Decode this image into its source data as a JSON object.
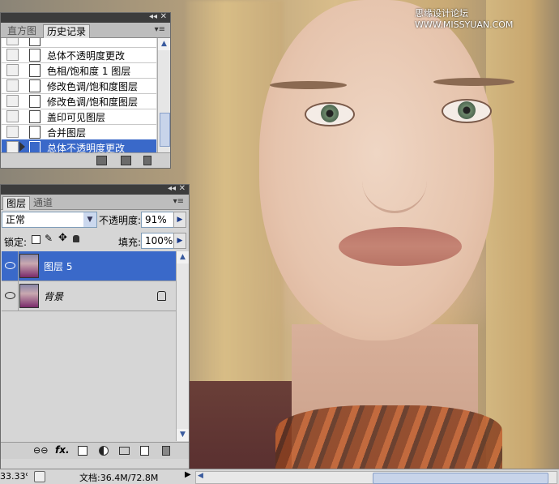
{
  "watermark": "思缘设计论坛 WWW.MISSYUAN.COM",
  "history_panel": {
    "tabs": [
      "直方图",
      "历史记录"
    ],
    "items": [
      {
        "label": "总体不透明度更改",
        "selected": false
      },
      {
        "label": "色相/饱和度 1 图层",
        "selected": false
      },
      {
        "label": "修改色调/饱和度图层",
        "selected": false
      },
      {
        "label": "修改色调/饱和度图层",
        "selected": false
      },
      {
        "label": "盖印可见图层",
        "selected": false
      },
      {
        "label": "合并图层",
        "selected": false
      },
      {
        "label": "总体不透明度更改",
        "selected": true
      }
    ]
  },
  "layers_panel": {
    "tabs": [
      "图层",
      "通道"
    ],
    "blend_mode": "正常",
    "opacity_label": "不透明度:",
    "opacity_value": "91%",
    "lock_label": "锁定:",
    "fill_label": "填充:",
    "fill_value": "100%",
    "layers": [
      {
        "name": "图层 5",
        "selected": true,
        "locked": false
      },
      {
        "name": "背景",
        "selected": false,
        "locked": true
      }
    ],
    "footer_fx": "fx."
  },
  "status_bar": {
    "zoom": "33.33%",
    "doc_info": "文档:36.4M/72.8M"
  },
  "colors": {
    "selection": "#3a69c9",
    "panel_bg": "#d6d6d6"
  }
}
